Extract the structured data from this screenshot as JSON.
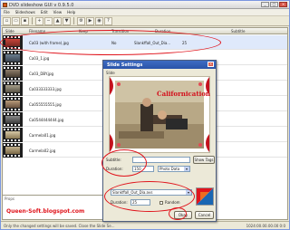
{
  "window": {
    "title": "DVD slideshow GUI v 0.9.5.0",
    "menu": [
      "File",
      "Slideshows",
      "Edit",
      "View",
      "Help"
    ]
  },
  "grid": {
    "columns": [
      "Slide",
      "Filename",
      "Keep",
      "Transition",
      "Duration",
      "Subtitle"
    ],
    "rows": [
      {
        "file": "Ca03 (with frame).jpg",
        "transition": "Slankffall_Out_Dia...",
        "duration": "25",
        "keep": "No"
      },
      {
        "file": "Ca03_1.jpg",
        "transition": "",
        "duration": "",
        "keep": ""
      },
      {
        "file": "Ca03_DBY.jpg",
        "transition": "",
        "duration": "",
        "keep": ""
      },
      {
        "file": "Ca033333333.jpg",
        "transition": "",
        "duration": "",
        "keep": ""
      },
      {
        "file": "Ca055555555.jpg",
        "transition": "",
        "duration": "",
        "keep": ""
      },
      {
        "file": "Ca0544444444.jpg",
        "transition": "",
        "duration": "",
        "keep": ""
      },
      {
        "file": "Carmela01.jpg",
        "transition": "",
        "duration": "",
        "keep": ""
      },
      {
        "file": "Carmela02.jpg",
        "transition": "",
        "duration": "",
        "keep": ""
      }
    ]
  },
  "props_label": "Props",
  "watermark": "Queen-Soft.blogspot.com",
  "status": {
    "left": "Only the changed settings will be saved. Close the Slide Se...",
    "right": "1024:00.00.00.00 0:0"
  },
  "dialog": {
    "title": "Slide Settings",
    "slide_label": "Slide",
    "photo_title": "Californication",
    "subtitle_label": "Subtitle:",
    "subtitle_value": "",
    "show_tags_label": "Show Tags",
    "duration_label": "Duration:",
    "duration_value": "150",
    "duration_unit": "Photo Data",
    "transition_value": "Slankffall_Out_Dia.avs",
    "trans_duration_label": "Duration:",
    "trans_duration_value": "25",
    "random_label": "Random",
    "ok_label": "Okay",
    "cancel_label": "Cancel"
  }
}
